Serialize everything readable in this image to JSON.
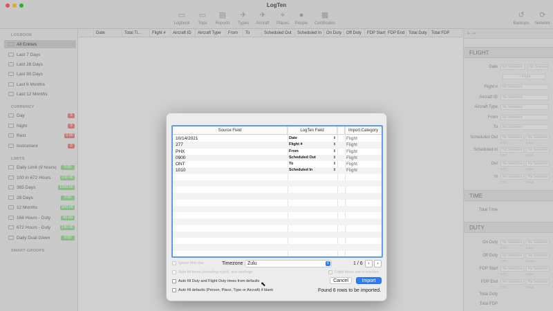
{
  "window": {
    "title": "LogTen"
  },
  "toolbar": {
    "left": [
      {
        "label": "Logbook",
        "icon": "logbook-icon",
        "glyph": "▭"
      },
      {
        "label": "Trips",
        "icon": "trips-icon",
        "glyph": "▭"
      },
      {
        "label": "Reports",
        "icon": "reports-icon",
        "glyph": "▤"
      },
      {
        "label": "Types",
        "icon": "types-icon",
        "glyph": "✈"
      },
      {
        "label": "Aircraft",
        "icon": "aircraft-icon",
        "glyph": "✈"
      },
      {
        "label": "Places",
        "icon": "places-icon",
        "glyph": "⌖"
      },
      {
        "label": "People",
        "icon": "people-icon",
        "glyph": "●"
      },
      {
        "label": "Certificates",
        "icon": "certificates-icon",
        "glyph": "▦"
      }
    ],
    "right": [
      {
        "label": "Backups",
        "icon": "backups-icon",
        "glyph": "↺"
      },
      {
        "label": "Network",
        "icon": "network-icon",
        "glyph": "⟳"
      }
    ]
  },
  "sidebar": {
    "sections": {
      "logbook": "LOGBOOK",
      "currency": "CURRENCY",
      "limits": "LIMITS",
      "smart_groups": "SMART GROUPS"
    },
    "logbook_items": [
      {
        "label": "All Entries"
      },
      {
        "label": "Last 7 Days"
      },
      {
        "label": "Last 28 Days"
      },
      {
        "label": "Last 90 Days"
      },
      {
        "label": "Last 6 Months"
      },
      {
        "label": "Last 12 Months"
      }
    ],
    "currency_items": [
      {
        "label": "Day",
        "badge": "0"
      },
      {
        "label": "Night",
        "badge": "0"
      },
      {
        "label": "Rest",
        "badge": "0:00"
      },
      {
        "label": "Instrument",
        "badge": "0"
      }
    ],
    "limit_items": [
      {
        "label": "Daily Limit (9 hours)",
        "badge": "0:00"
      },
      {
        "label": "100 in 672 Hours",
        "badge": "100:00"
      },
      {
        "label": "365 Days",
        "badge": "1000:00"
      },
      {
        "label": "28 Days",
        "badge": "0:00"
      },
      {
        "label": "12 Months",
        "badge": "900:00"
      },
      {
        "label": "168 Hours - Duty",
        "badge": "60:00"
      },
      {
        "label": "672 Hours - Duty",
        "badge": "190:00"
      },
      {
        "label": "Daily Dual Given",
        "badge": "0:00"
      }
    ]
  },
  "log_table": {
    "columns": [
      "Date",
      "Total Ti...",
      "Flight #",
      "Aircraft ID",
      "Aircraft Type",
      "From",
      "To",
      "Scheduled Out",
      "Scheduled In",
      "On Duty",
      "Off Duty",
      "FDP Start",
      "FDP End",
      "Total Duty",
      "Total FDP"
    ]
  },
  "detail_panel": {
    "sections": {
      "flight": "FLIGHT",
      "time": "TIME",
      "duty": "DUTY"
    },
    "placeholder": "No Selection",
    "flight_button": "+ Flight",
    "labels": {
      "date": "Date",
      "flight_no": "Flight #",
      "aircraft_id": "Aircraft ID",
      "aircraft_type": "Aircraft Type",
      "from": "From",
      "to": "To",
      "scheduled_out": "Scheduled Out",
      "scheduled_in": "Scheduled In",
      "out": "Out",
      "in": "In",
      "total_time": "Total Time",
      "on_duty": "On Duty",
      "off_duty": "Off Duty",
      "fdp_start": "FDP Start",
      "fdp_end": "FDP End",
      "total_duty": "Total Duty",
      "total_fdp": "Total FDP"
    },
    "sub_labels": {
      "utc": "UTC",
      "local": "Local"
    }
  },
  "import_dialog": {
    "columns": {
      "source": "Source Field",
      "logten": "LogTen Field",
      "category": "Import Category"
    },
    "rows": [
      {
        "source": "10/14/2021",
        "field": "Date",
        "category": "Flight"
      },
      {
        "source": "277",
        "field": "Flight #",
        "category": "Flight"
      },
      {
        "source": "PHX",
        "field": "From",
        "category": "Flight"
      },
      {
        "source": "0900",
        "field": "Scheduled Out",
        "category": "Flight"
      },
      {
        "source": "ONT",
        "field": "To",
        "category": "Flight"
      },
      {
        "source": "1010",
        "field": "Scheduled In",
        "category": "Flight"
      }
    ],
    "options": {
      "ignore_first_row": "Ignore first row",
      "auto_fill_times": "Auto fill times (including night), and landings",
      "auto_fill_duty": "Auto fill Duty and Flight Duty times from defaults",
      "auto_fill_defaults": "Auto fill defaults (Person, Place, Type or Aircraft) if blank",
      "minutes_note": "Flight times are in minutes"
    },
    "timezone": {
      "label": "Timezone",
      "value": "Zulu"
    },
    "pagination": {
      "label": "1 / 6",
      "prev": "‹",
      "next": "›"
    },
    "buttons": {
      "cancel": "Cancel",
      "import": "Import"
    },
    "status": "Found 6 rows to be imported."
  },
  "colors": {
    "accent": "#2f7cf6",
    "selection_border": "#5c9ce6",
    "badge_red": "#e38a83",
    "badge_green": "#9fd69a"
  }
}
